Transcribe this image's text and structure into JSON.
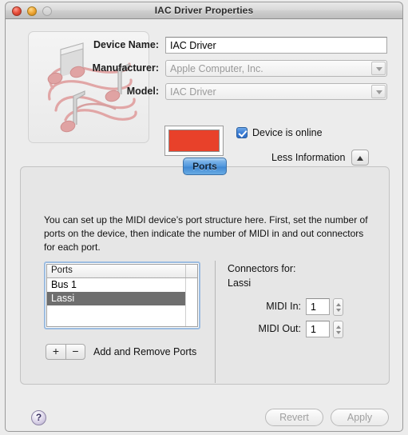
{
  "window": {
    "title": "IAC Driver Properties",
    "traffic_lights": [
      "close-button",
      "minimize-button",
      "zoom-button"
    ]
  },
  "device": {
    "icon_name": "midi-music-notes-icon",
    "fields": [
      {
        "label": "Device Name:",
        "value": "IAC Driver",
        "type": "textfield"
      },
      {
        "label": "Manufacturer:",
        "value": "Apple Computer, Inc.",
        "type": "popup"
      },
      {
        "label": "Model:",
        "value": "IAC Driver",
        "type": "popup"
      }
    ],
    "color_swatch": "#e8412a",
    "online_label": "Device is online",
    "online_checked": true,
    "less_information_label": "Less Information",
    "disclosure_icon": "triangle-up-icon"
  },
  "tabs": [
    {
      "label": "Ports",
      "selected": true
    }
  ],
  "ports_pane": {
    "help_text": "You can set up the MIDI device’s port structure here.  First, set the number of ports on the device, then indicate the number of MIDI in and out connectors for each port.",
    "list_header": "Ports",
    "rows": [
      {
        "label": "Bus 1",
        "selected": false
      },
      {
        "label": "Lassi",
        "selected": true
      }
    ],
    "add_button": "+",
    "remove_button": "−",
    "add_remove_label": "Add and Remove Ports"
  },
  "connectors": {
    "title": "Connectors for:",
    "port_name": "Lassi",
    "steppers": [
      {
        "label": "MIDI In:",
        "value": "1"
      },
      {
        "label": "MIDI Out:",
        "value": "1"
      }
    ]
  },
  "footer": {
    "help_label": "?",
    "revert_label": "Revert",
    "apply_label": "Apply"
  }
}
